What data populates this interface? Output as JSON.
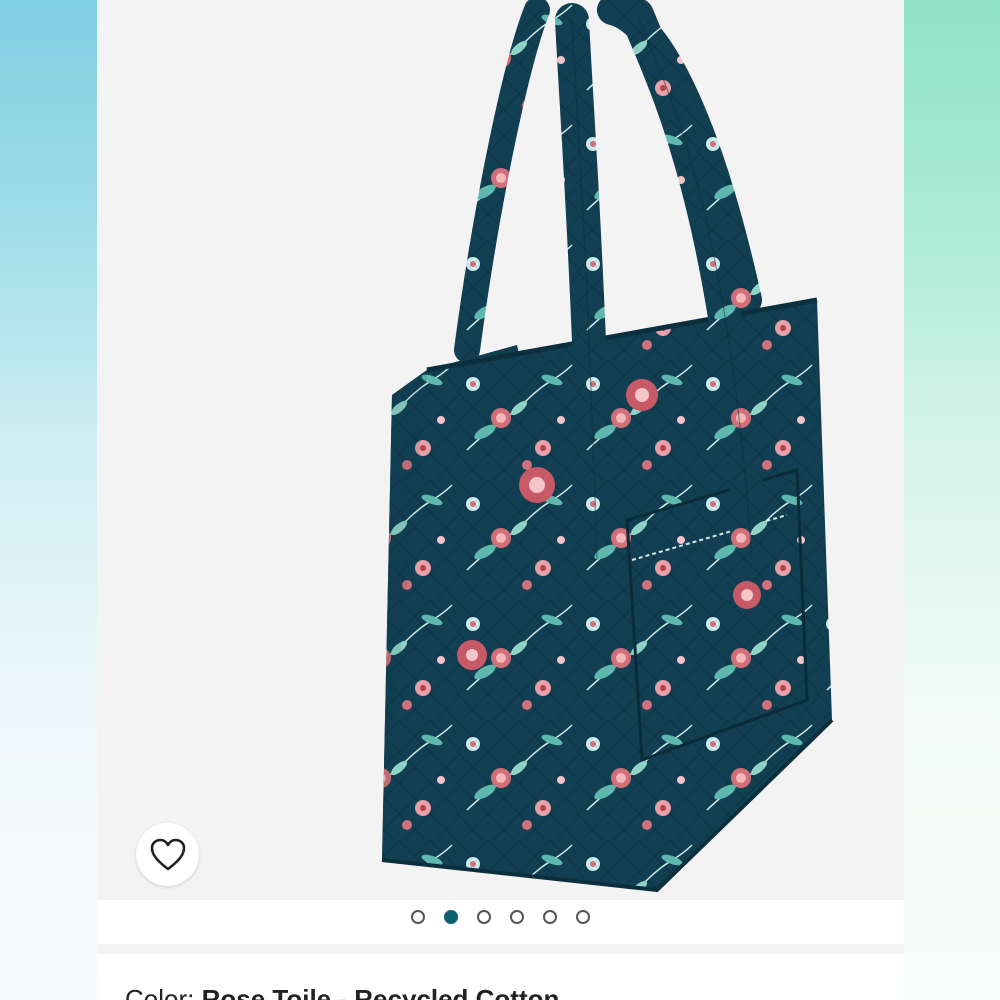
{
  "product": {
    "color_label": "Color:",
    "color_value": "Rose Toile - Recycled Cotton",
    "image_alt": "Vera Bradley tote bag in Rose Toile floral print"
  },
  "carousel": {
    "total": 6,
    "active_index": 1
  },
  "favorite": {
    "icon": "heart-icon"
  },
  "colors": {
    "bag_base": "#123f52",
    "flower_pink": "#d1707a",
    "leaf_teal": "#5fb8ae",
    "active_dot": "#0e5f6e"
  }
}
